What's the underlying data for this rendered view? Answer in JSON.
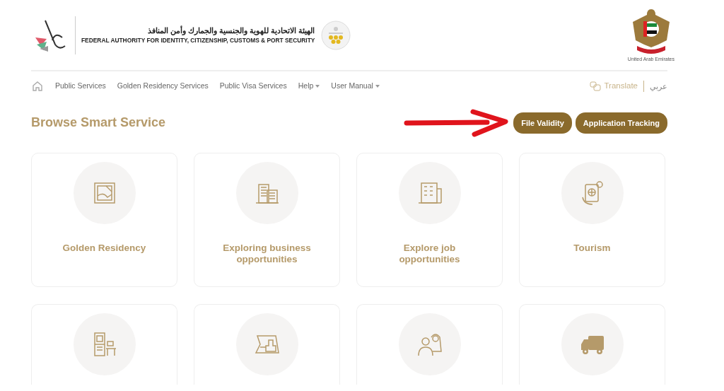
{
  "header": {
    "authority_name_ar": "الهيئة الاتحادية للهوية والجنسية والجمارك وأمن المنافذ",
    "authority_name_en": "FEDERAL AUTHORITY FOR IDENTITY, CITIZENSHIP, CUSTOMS & PORT SECURITY",
    "emblem_caption": "United Arab Emirates"
  },
  "nav": {
    "items": [
      {
        "label": "Public Services",
        "dropdown": false
      },
      {
        "label": "Golden Residency Services",
        "dropdown": false
      },
      {
        "label": "Public Visa Services",
        "dropdown": false
      },
      {
        "label": "Help",
        "dropdown": true
      },
      {
        "label": "User Manual",
        "dropdown": true
      }
    ],
    "translate": "Translate",
    "language": "عربي"
  },
  "heading": "Browse Smart Service",
  "buttons": [
    "File Validity",
    "Application Tracking"
  ],
  "cards": [
    {
      "kind": "frame",
      "title": "Golden Residency"
    },
    {
      "kind": "building",
      "title": "Exploring business opportunities"
    },
    {
      "kind": "office",
      "title": "Explore job opportunities"
    },
    {
      "kind": "passport",
      "title": "Tourism"
    },
    {
      "kind": "cabinet"
    },
    {
      "kind": "stamp"
    },
    {
      "kind": "people"
    },
    {
      "kind": "truck"
    }
  ]
}
